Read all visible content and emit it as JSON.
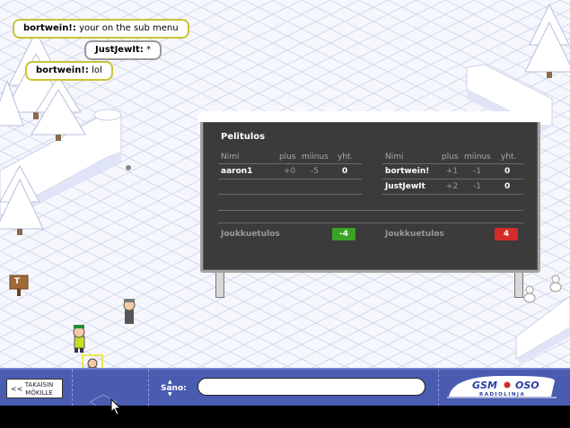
{
  "chat": [
    {
      "user": "bortwein!:",
      "text": "your on the sub menu",
      "style": "yellow"
    },
    {
      "user": "JustJewIt:",
      "text": "*",
      "style": "grey"
    },
    {
      "user": "bortwein!:",
      "text": "lol",
      "style": "yellow"
    }
  ],
  "scoreboard": {
    "title": "Pelitulos",
    "headers": {
      "name": "Nimi",
      "plus": "plus",
      "minus": "miinus",
      "total": "yht."
    },
    "team_label": "Joukkuetulos",
    "left_team": {
      "color": "#3aa324",
      "score": "-4",
      "players": [
        {
          "name": "aaron1",
          "plus": "+0",
          "minus": "-5",
          "total": "0"
        }
      ]
    },
    "right_team": {
      "color": "#d42a2a",
      "score": "4",
      "players": [
        {
          "name": "bortwein!",
          "plus": "+1",
          "minus": "-1",
          "total": "0"
        },
        {
          "name": "JustJewIt",
          "plus": "+2",
          "minus": "-1",
          "total": "0"
        }
      ]
    }
  },
  "bottom_bar": {
    "back_button": {
      "arrows": "<<",
      "line1": "TAKAISIN",
      "line2": "MÖKILLE"
    },
    "say_label": "Sano:",
    "say_input_value": "",
    "logo": {
      "top": "GSM",
      "top_right": "OSO",
      "bottom": "RADIOLINJA"
    }
  },
  "sign_letter": "T",
  "colors": {
    "bar": "#4a5cb0",
    "snow": "#ffffff",
    "grid": "#cfd6ee",
    "board": "#3b3b3b"
  }
}
